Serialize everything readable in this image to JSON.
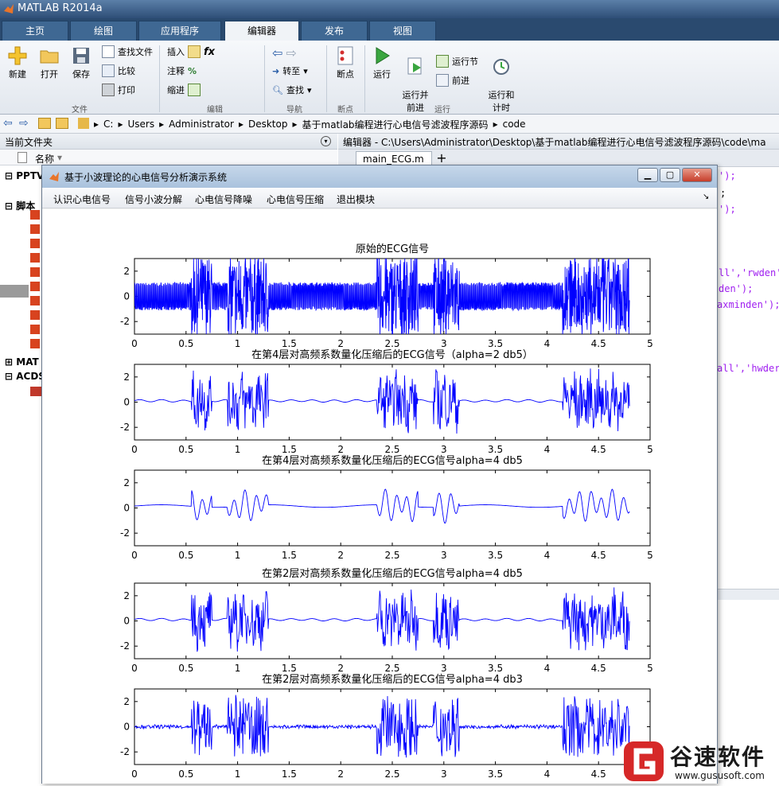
{
  "app": {
    "title": "MATLAB R2014a"
  },
  "ribbon": {
    "tabs": [
      "主页",
      "绘图",
      "应用程序",
      "编辑器",
      "发布",
      "视图"
    ],
    "active_tab": "编辑器",
    "file_group": {
      "label": "文件",
      "new": "新建",
      "open": "打开",
      "save": "保存",
      "find_files": "查找文件",
      "compare": "比较",
      "print": "打印"
    },
    "edit_group": {
      "label": "编辑",
      "insert": "插入",
      "comment": "注释",
      "indent": "缩进"
    },
    "nav_group": {
      "label": "导航",
      "goto": "转至",
      "find": "查找"
    },
    "breakpoints_group": {
      "label": "断点",
      "breakpoints": "断点"
    },
    "run_group": {
      "label": "运行",
      "run": "运行",
      "run_advance": "运行并\n前进",
      "run_section": "运行节",
      "advance": "前进",
      "run_time": "运行和\n计时"
    }
  },
  "address": {
    "segments": [
      "C:",
      "Users",
      "Administrator",
      "Desktop",
      "基于matlab编程进行心电信号滤波程序源码",
      "code"
    ]
  },
  "current_folder": {
    "title": "当前文件夹",
    "column_name": "名称",
    "items": [
      "PPTV",
      "脚本",
      "MAT",
      "ACDS"
    ]
  },
  "editor": {
    "title": "编辑器 - C:\\Users\\Administrator\\Desktop\\基于matlab编程进行心电信号滤波程序源码\\code\\ma",
    "tab": "main_ECG.m",
    "code_fragments": [
      {
        "text": "');",
        "color": "#a020f0"
      },
      {
        "text": ";",
        "color": "#000000"
      },
      {
        "text": "');",
        "color": "#a020f0"
      },
      {
        "text": "ll','rwden')",
        "color": "#a020f0"
      },
      {
        "text": "den');",
        "color": "#a020f0"
      },
      {
        "text": "axminden');",
        "color": "#a020f0"
      },
      {
        "text": "all','hwder",
        "color": "#a020f0"
      }
    ]
  },
  "figure": {
    "title": "基于小波理论的心电信号分析演示系统",
    "menu": [
      "认识心电信号",
      "信号小波分解",
      "心电信号降噪",
      "心电信号压缩",
      "退出模块"
    ]
  },
  "chart_data": [
    {
      "type": "line",
      "title": "原始的ECG信号",
      "xlim": [
        0,
        5
      ],
      "ylim": [
        -3,
        3
      ],
      "xticks": [
        "0",
        "0.5",
        "1",
        "1.5",
        "2",
        "2.5",
        "3",
        "3.5",
        "4",
        "4.5",
        "5"
      ],
      "yticks": [
        "2",
        "0",
        "-2"
      ],
      "x_end": 4.8,
      "color": "#0000ff",
      "style": "dense"
    },
    {
      "type": "line",
      "title": "在第4层对高频系数量化压缩后的ECG信号（alpha=2 db5）",
      "xlim": [
        0,
        5
      ],
      "ylim": [
        -3,
        3
      ],
      "xticks": [
        "0",
        "0.5",
        "1",
        "1.5",
        "2",
        "2.5",
        "3",
        "3.5",
        "4",
        "4.5",
        "5"
      ],
      "yticks": [
        "2",
        "0",
        "-2"
      ],
      "x_end": 4.8,
      "color": "#0000ff",
      "style": "medium"
    },
    {
      "type": "line",
      "title": "在第4层对高频系数量化压缩后的ECG信号alpha=4 db5",
      "xlim": [
        0,
        5
      ],
      "ylim": [
        -3,
        3
      ],
      "xticks": [
        "0",
        "0.5",
        "1",
        "1.5",
        "2",
        "2.5",
        "3",
        "3.5",
        "4",
        "4.5",
        "5"
      ],
      "yticks": [
        "2",
        "0",
        "-2"
      ],
      "x_end": 4.8,
      "color": "#0000ff",
      "style": "smooth"
    },
    {
      "type": "line",
      "title": "在第2层对高频系数量化压缩后的ECG信号alpha=4 db5",
      "xlim": [
        0,
        5
      ],
      "ylim": [
        -3,
        3
      ],
      "xticks": [
        "0",
        "0.5",
        "1",
        "1.5",
        "2",
        "2.5",
        "3",
        "3.5",
        "4",
        "4.5",
        "5"
      ],
      "yticks": [
        "2",
        "0",
        "-2"
      ],
      "x_end": 4.8,
      "color": "#0000ff",
      "style": "medium"
    },
    {
      "type": "line",
      "title": "在第2层对高频系数量化压缩后的ECG信号alpha=4 db3",
      "xlim": [
        0,
        5
      ],
      "ylim": [
        -3,
        3
      ],
      "xticks": [
        "0",
        "0.5",
        "1",
        "1.5",
        "2",
        "2.5",
        "3",
        "3.5",
        "4",
        "4.5",
        "5"
      ],
      "yticks": [
        "2",
        "0",
        "-2"
      ],
      "x_end": 4.8,
      "color": "#0000ff",
      "style": "noisy"
    }
  ],
  "watermark": {
    "name": "谷速软件",
    "url": "www.gususoft.com"
  }
}
